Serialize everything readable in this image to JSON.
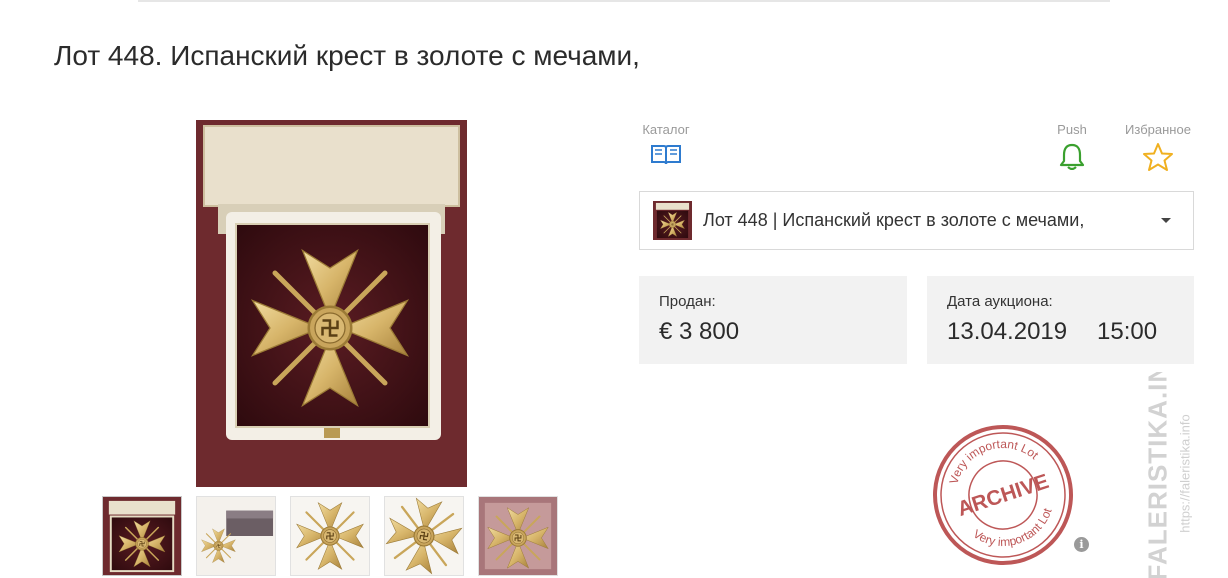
{
  "page": {
    "title": "Лот 448. Испанский крест в золоте с мечами,"
  },
  "actions": {
    "catalog": {
      "label": "Каталог",
      "icon": "book-icon",
      "color": "#2e7bcf"
    },
    "push": {
      "label": "Push",
      "icon": "bell-icon",
      "color": "#3aa02e"
    },
    "favorites": {
      "label": "Избранное",
      "icon": "star-icon",
      "color": "#f0b020"
    }
  },
  "lot_selector": {
    "selected": "Лот 448 | Испанский крест в золоте с мечами,"
  },
  "sale": {
    "sold_label": "Продан:",
    "sold_value": "€ 3 800",
    "date_label": "Дата аукциона:",
    "date_value": "13.04.2019",
    "time_value": "15:00"
  },
  "stamp": {
    "top_text": "Very important Lot",
    "center_text": "ARCHIVE",
    "bottom_text": "Very important Lot",
    "color": "#b23a3a"
  },
  "info_icon": {
    "glyph": "i"
  },
  "watermark": {
    "site": "FALERISTIKA.INFO",
    "url": "https://faleristika.info"
  },
  "gallery": {
    "thumbnail_count": 5,
    "active_index": 0
  }
}
